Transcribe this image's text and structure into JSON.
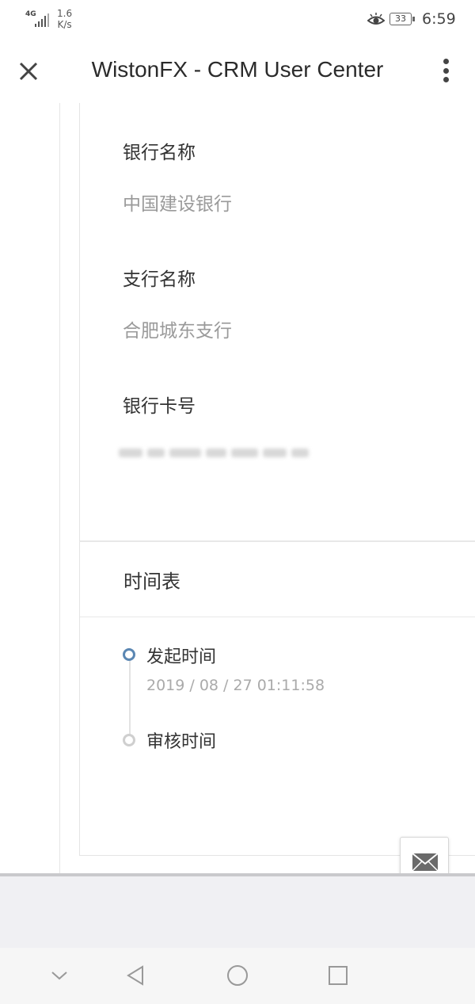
{
  "status_bar": {
    "network": "4G",
    "speed_value": "1.6",
    "speed_unit": "K/s",
    "battery": "33",
    "time": "6:59"
  },
  "header": {
    "title": "WistonFX - CRM User Center",
    "close_icon": "close-icon",
    "menu_icon": "more-vertical-icon"
  },
  "bank_info": {
    "bank_name_label": "银行名称",
    "bank_name_value": "中国建设银行",
    "branch_name_label": "支行名称",
    "branch_name_value": "合肥城东支行",
    "card_number_label": "银行卡号"
  },
  "timeline": {
    "title": "时间表",
    "items": [
      {
        "label": "发起时间",
        "time": "2019 / 08 / 27 01:11:58"
      },
      {
        "label": "审核时间",
        "time": ""
      }
    ]
  },
  "floating": {
    "icon": "mail-icon"
  },
  "colors": {
    "timeline_active": "#5b87b3",
    "timeline_idle": "#cfcfcf",
    "value_text": "#9a9a9a"
  }
}
